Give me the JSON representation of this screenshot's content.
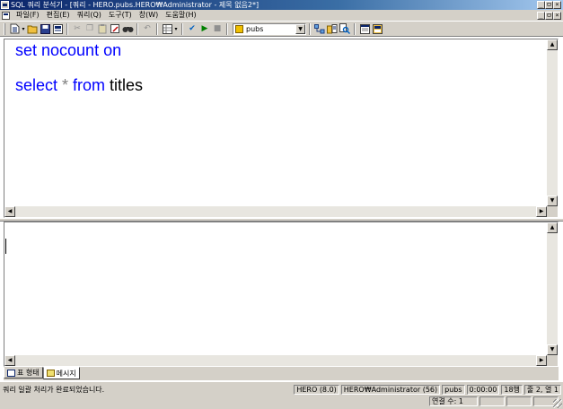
{
  "window": {
    "title": "SQL 쿼리 분석기 - [쿼리 - HERO.pubs.HERO₩Administrator - 제목 없음2*]",
    "controls": [
      "_",
      "ㅁ",
      "×"
    ]
  },
  "menu": {
    "items": [
      "파일(F)",
      "편집(E)",
      "쿼리(Q)",
      "도구(T)",
      "창(W)",
      "도움말(H)"
    ]
  },
  "toolbar": {
    "database": "pubs",
    "icons": [
      "new-query-icon",
      "open-icon",
      "save-icon",
      "insert-template-icon",
      "cut-icon",
      "copy-icon",
      "paste-icon",
      "clear-window-icon",
      "find-icon",
      "undo-icon",
      "execute-mode-icon",
      "parse-check-icon",
      "execute-play-icon",
      "stop-icon",
      "database-icon",
      "show-execution-plan-icon",
      "object-browser-icon",
      "object-search-icon",
      "properties-icon",
      "results-pane-icon"
    ]
  },
  "editor": {
    "lines": [
      {
        "kw1": "set nocount on",
        "op": "",
        "kw2": "",
        "txt": ""
      },
      {
        "kw1": "select",
        "op": " * ",
        "kw2": "from",
        "txt": " titles"
      }
    ]
  },
  "tabs": {
    "grid": "표 형태",
    "messages": "메시지"
  },
  "status": {
    "message": "쿼리 일괄 처리가 완료되었습니다.",
    "server": "HERO (8.0)",
    "user": "HERO₩Administrator (56)",
    "database": "pubs",
    "time": "0:00:00",
    "rows": "18행",
    "position": "줄 2, 열 1",
    "connections": "연결 수: 1"
  },
  "colors": {
    "keyword": "#0000ff",
    "operator": "#808080",
    "titlebar": "#0a246a",
    "chrome": "#d4d0c8"
  }
}
